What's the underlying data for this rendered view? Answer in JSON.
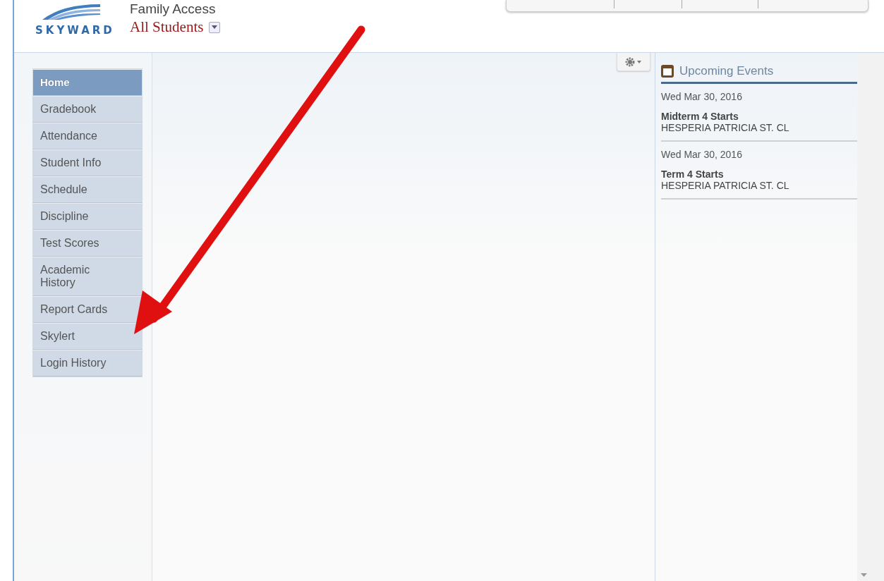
{
  "header": {
    "logo": "SKYWARD",
    "app_title": "Family Access",
    "student_selector": "All Students"
  },
  "nav": [
    {
      "label": "Home",
      "selected": true
    },
    {
      "label": "Gradebook",
      "selected": false
    },
    {
      "label": "Attendance",
      "selected": false
    },
    {
      "label": "Student Info",
      "selected": false
    },
    {
      "label": "Schedule",
      "selected": false
    },
    {
      "label": "Discipline",
      "selected": false
    },
    {
      "label": "Test Scores",
      "selected": false
    },
    {
      "label": "Academic History",
      "selected": false
    },
    {
      "label": "Report Cards",
      "selected": false
    },
    {
      "label": "Skylert",
      "selected": false
    },
    {
      "label": "Login History",
      "selected": false
    }
  ],
  "events": {
    "title": "Upcoming Events",
    "items": [
      {
        "date": "Wed Mar 30, 2016",
        "name": "Midterm 4 Starts",
        "school": "HESPERIA PATRICIA ST. CL"
      },
      {
        "date": "Wed Mar 30, 2016",
        "name": "Term 4 Starts",
        "school": "HESPERIA PATRICIA ST. CL"
      }
    ]
  }
}
